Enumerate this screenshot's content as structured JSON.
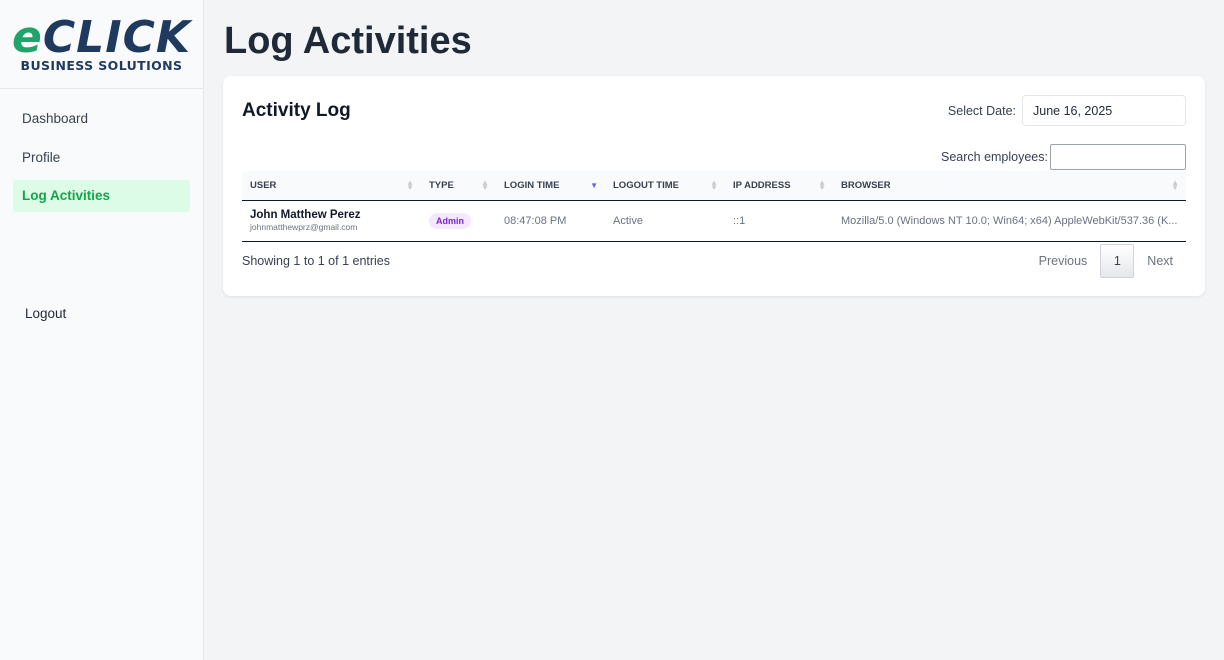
{
  "brand": {
    "logo_e": "e",
    "logo_main": "CLICK",
    "logo_sub": "BUSINESS SOLUTIONS",
    "color_green": "#22a36b",
    "color_navy": "#1e3a5f"
  },
  "sidebar": {
    "items": [
      {
        "label": "Dashboard",
        "active": false
      },
      {
        "label": "Profile",
        "active": false
      },
      {
        "label": "Log Activities",
        "active": true
      }
    ],
    "logout_label": "Logout"
  },
  "page": {
    "title": "Log Activities"
  },
  "card": {
    "title": "Activity Log",
    "date_label": "Select Date:",
    "date_value": "June 16, 2025",
    "search_label": "Search employees:",
    "search_value": ""
  },
  "table": {
    "columns": [
      "USER",
      "TYPE",
      "LOGIN TIME",
      "LOGOUT TIME",
      "IP ADDRESS",
      "BROWSER"
    ],
    "sorted_column": "LOGIN TIME",
    "rows": [
      {
        "name": "John Matthew Perez",
        "email": "johnmatthewprz@gmail.com",
        "type": "Admin",
        "login_time": "08:47:08 PM",
        "logout_time": "Active",
        "ip": "::1",
        "browser": "Mozilla/5.0 (Windows NT 10.0; Win64; x64) AppleWebKit/537.36 (K..."
      }
    ]
  },
  "footer": {
    "info": "Showing 1 to 1 of 1 entries",
    "previous_label": "Previous",
    "current_page": "1",
    "next_label": "Next"
  },
  "icons": {
    "sort_both": "sort-icon",
    "sort_desc": "sort-desc-icon"
  }
}
